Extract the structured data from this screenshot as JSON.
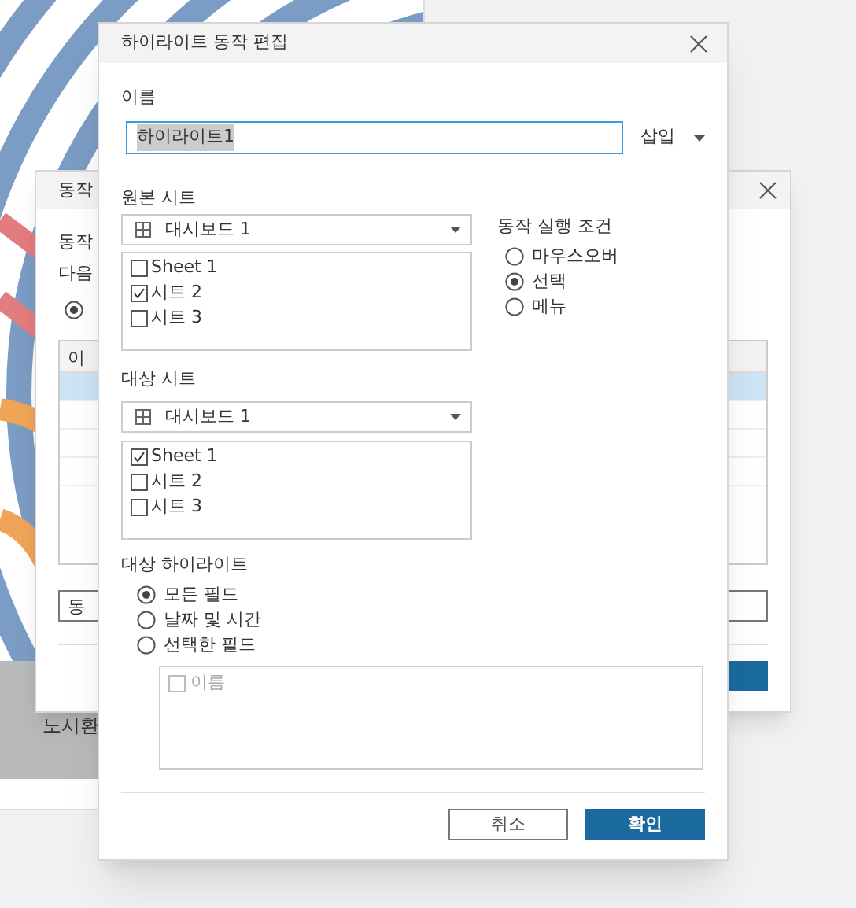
{
  "dashboard": {
    "band_label": "노시환"
  },
  "back_dialog": {
    "title": "동작",
    "lines": [
      "동작",
      "다음"
    ],
    "option_selected": true,
    "table": {
      "column_1": "이",
      "rows": [
        {
          "selected": true
        },
        {
          "selected": false
        },
        {
          "selected": false
        },
        {
          "selected": false
        }
      ]
    },
    "input_value": "동"
  },
  "dialog": {
    "title": "하이라이트 동작 편집",
    "name_label": "이름",
    "name_value": "하이라이트1",
    "insert_label": "삽입",
    "source": {
      "label": "원본 시트",
      "dropdown": "대시보드 1",
      "sheets": [
        {
          "label": "Sheet 1",
          "checked": false
        },
        {
          "label": "시트 2",
          "checked": true
        },
        {
          "label": "시트 3",
          "checked": false
        }
      ]
    },
    "run_condition": {
      "label": "동작 실행 조건",
      "options": [
        {
          "label": "마우스오버",
          "selected": false
        },
        {
          "label": "선택",
          "selected": true
        },
        {
          "label": "메뉴",
          "selected": false
        }
      ]
    },
    "target": {
      "label": "대상 시트",
      "dropdown": "대시보드 1",
      "sheets": [
        {
          "label": "Sheet 1",
          "checked": true
        },
        {
          "label": "시트 2",
          "checked": false
        },
        {
          "label": "시트 3",
          "checked": false
        }
      ]
    },
    "target_highlight": {
      "label": "대상 하이라이트",
      "options": [
        {
          "label": "모든 필드",
          "selected": true
        },
        {
          "label": "날짜 및 시간",
          "selected": false
        },
        {
          "label": "선택한 필드",
          "selected": false
        }
      ],
      "fields": [
        {
          "label": "이름",
          "checked": false,
          "disabled": true
        }
      ]
    },
    "buttons": [
      {
        "label": "취소",
        "kind": "secondary"
      },
      {
        "label": "확인",
        "kind": "primary"
      }
    ]
  }
}
